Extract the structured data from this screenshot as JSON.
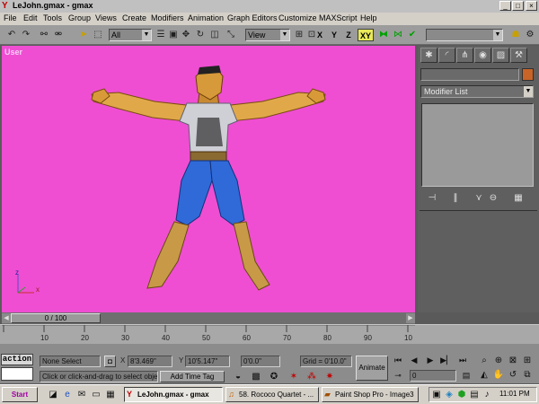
{
  "window": {
    "title": "LeJohn.gmax - gmax",
    "app_icon": "gmax-app-icon",
    "controls": [
      "_",
      "□",
      "×"
    ]
  },
  "menu": [
    "File",
    "Edit",
    "Tools",
    "Group",
    "Views",
    "Create",
    "Modifiers",
    "Animation",
    "Graph Editors",
    "Customize",
    "MAXScript",
    "Help"
  ],
  "toolbar": {
    "selection_filter": "All",
    "ref_coord": "View",
    "axis_x": "X",
    "axis_y": "Y",
    "axis_z": "Z",
    "axis_xy": "XY"
  },
  "viewport": {
    "label": "User",
    "axis_x": "x",
    "axis_z": "z"
  },
  "command_panel": {
    "modifier_list": "Modifier List",
    "name_field": "",
    "color_swatch": "#c86428"
  },
  "time_slider": {
    "frame": "0 / 100",
    "ticks": [
      "10",
      "20",
      "30",
      "40",
      "50",
      "60",
      "70",
      "80",
      "90",
      "10"
    ]
  },
  "status": {
    "maxscript_label": "action",
    "selection": "None Select",
    "prompt": "Click or click-and-drag to select obje",
    "x_label": "X",
    "x_value": "8'3.469\"",
    "y_label": "Y",
    "y_value": "10'5.147\"",
    "z_value": "0'0.0\"",
    "grid": "Grid = 0'10.0\"",
    "add_time_tag": "Add Time Tag",
    "animate": "Animate",
    "frame_field": "0"
  },
  "taskbar": {
    "start": "Start",
    "tasks": [
      {
        "label": "LeJohn.gmax - gmax",
        "active": true
      },
      {
        "label": "58. Rococo Quartet - ...",
        "active": false
      },
      {
        "label": "Paint Shop Pro - Image3",
        "active": false
      }
    ],
    "clock": "11:01 PM"
  }
}
